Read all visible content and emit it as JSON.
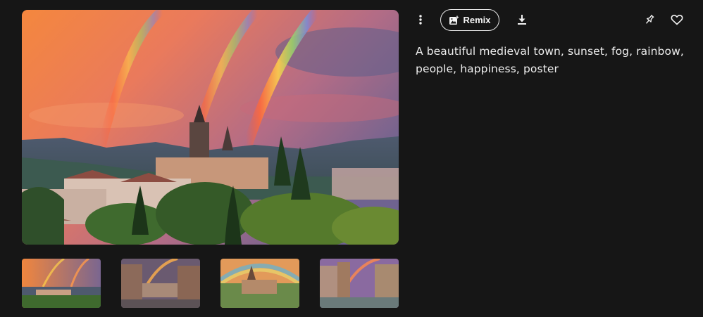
{
  "toolbar": {
    "more_icon": "more-vertical-icon",
    "remix_label": "Remix",
    "remix_icon": "image-add-icon",
    "download_icon": "download-icon",
    "pin_icon": "pin-icon",
    "like_icon": "heart-icon"
  },
  "prompt": {
    "text": "A beautiful medieval town, sunset, fog, rainbow, people, happiness, poster"
  },
  "thumbnails": [
    {
      "subject": "medieval town with rainbows at sunset"
    },
    {
      "subject": "street with half-timbered houses and rainbow"
    },
    {
      "subject": "painted village poster with rainbow"
    },
    {
      "subject": "medieval street with people and rainbow"
    }
  ],
  "colors": {
    "background": "#161616",
    "text": "#eeeeee",
    "sky_orange": "#f07a3c",
    "sky_purple": "#7a5f8e"
  }
}
